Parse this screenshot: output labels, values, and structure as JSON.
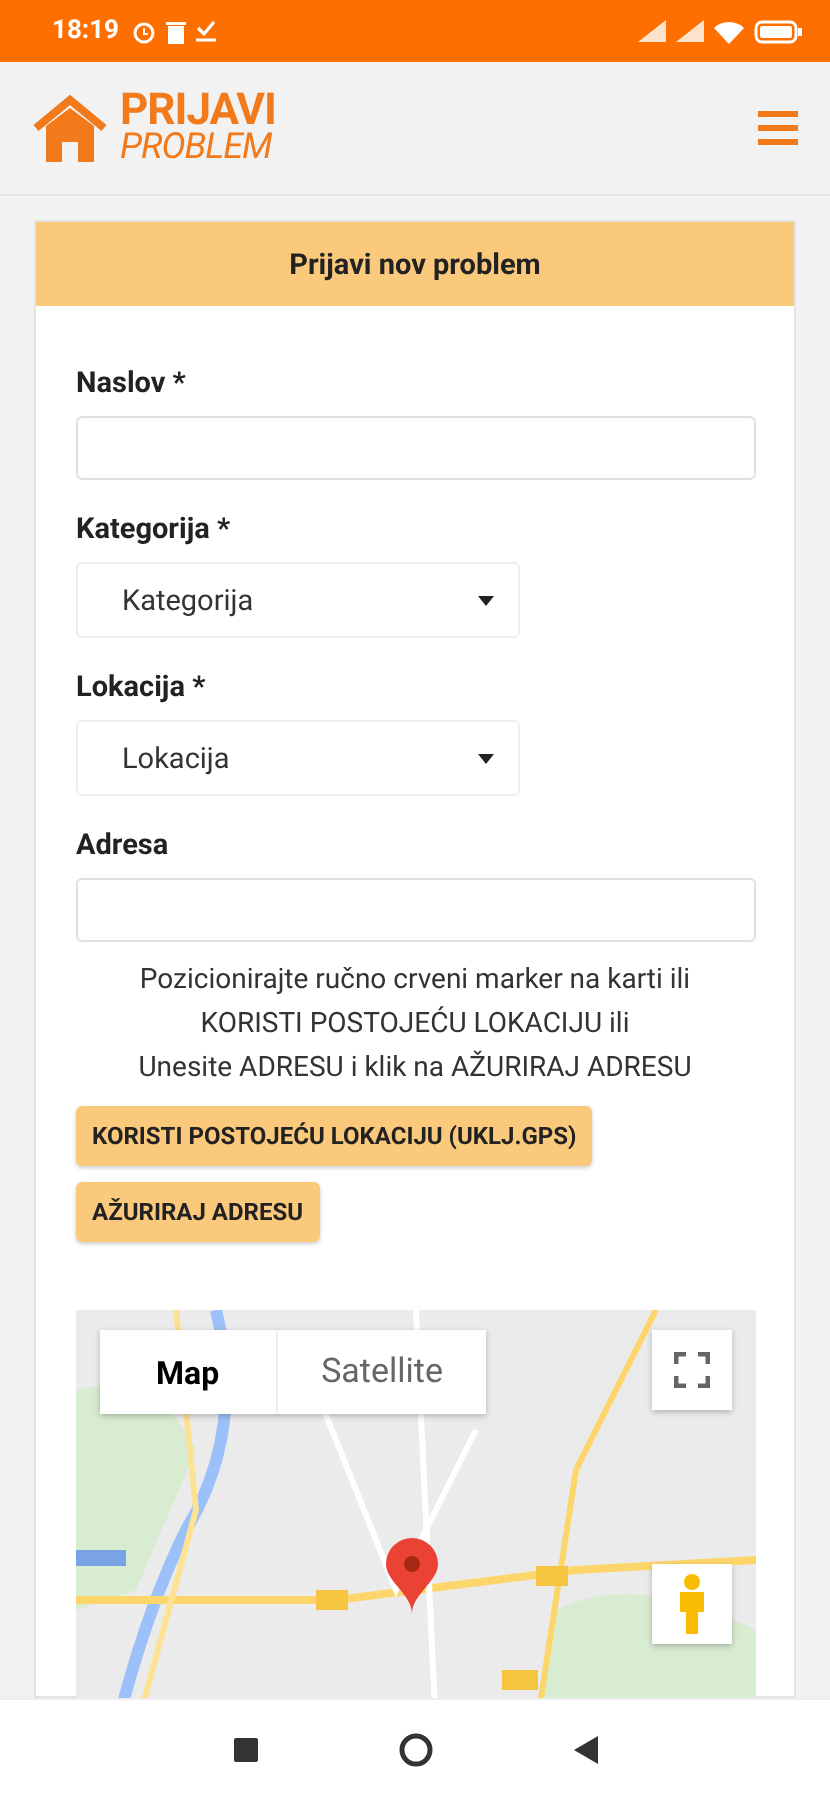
{
  "status_bar": {
    "time": "18:19"
  },
  "header": {
    "logo_top": "PRIJAVI",
    "logo_bottom": "PROBLEM"
  },
  "card": {
    "title": "Prijavi nov problem"
  },
  "form": [
    {
      "kind": "text",
      "label": "Naslov *"
    },
    {
      "kind": "select",
      "label": "Kategorija *",
      "value": "Kategorija"
    },
    {
      "kind": "select",
      "label": "Lokacija *",
      "value": "Lokacija"
    },
    {
      "kind": "text",
      "label": "Adresa"
    }
  ],
  "instructions": [
    "Pozicionirajte ručno crveni marker na karti ili",
    "KORISTI POSTOJEĆU LOKACIJU ili",
    "Unesite ADRESU i klik na AŽURIRAJ ADRESU"
  ],
  "buttons": [
    "KORISTI POSTOJEĆU LOKACIJU (UKLJ.GPS)",
    "AŽURIRAJ ADRESU"
  ],
  "map": {
    "kind": "picture",
    "map_types": [
      {
        "label": "Map",
        "selected": true
      },
      {
        "label": "Satellite",
        "selected": false
      }
    ]
  }
}
